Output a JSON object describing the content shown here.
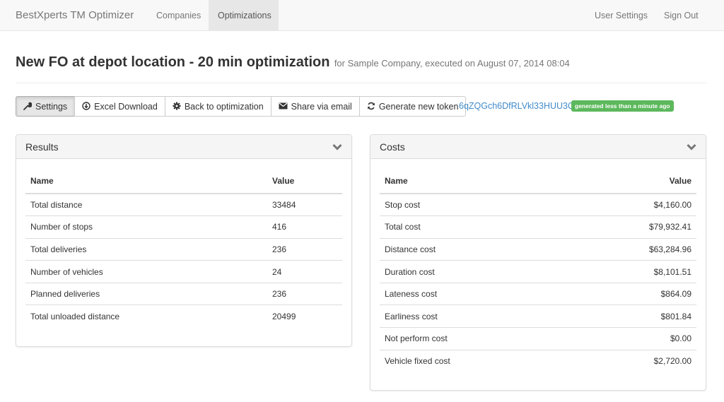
{
  "navbar": {
    "brand": "BestXperts TM Optimizer",
    "left_items": [
      {
        "label": "Companies",
        "active": false
      },
      {
        "label": "Optimizations",
        "active": true
      }
    ],
    "right_items": [
      {
        "label": "User Settings"
      },
      {
        "label": "Sign Out"
      }
    ]
  },
  "header": {
    "title": "New FO at depot location - 20 min optimization",
    "subtitle": "for Sample Company, executed on August 07, 2014 08:04"
  },
  "toolbar": {
    "buttons": [
      {
        "label": "Settings",
        "icon": "wrench-icon",
        "active": true
      },
      {
        "label": "Excel Download",
        "icon": "download-circle-icon",
        "active": false
      },
      {
        "label": "Back to optimization",
        "icon": "cog-icon",
        "active": false
      },
      {
        "label": "Share via email",
        "icon": "envelope-icon",
        "active": false
      },
      {
        "label": "Generate new token",
        "icon": "refresh-icon",
        "active": false
      }
    ],
    "token": "6qZQGch6DfRLVkl33HUU3Q",
    "token_badge": "generated less than a minute ago",
    "badge_color": "#5cb85c",
    "link_color": "#428bca"
  },
  "results": {
    "title": "Results",
    "columns": [
      "Name",
      "Value"
    ],
    "rows": [
      {
        "name": "Total distance",
        "value": "33484"
      },
      {
        "name": "Number of stops",
        "value": "416"
      },
      {
        "name": "Total deliveries",
        "value": "236"
      },
      {
        "name": "Number of vehicles",
        "value": "24"
      },
      {
        "name": "Planned deliveries",
        "value": "236"
      },
      {
        "name": "Total unloaded distance",
        "value": "20499"
      }
    ]
  },
  "costs": {
    "title": "Costs",
    "columns": [
      "Name",
      "Value"
    ],
    "rows": [
      {
        "name": "Stop cost",
        "value": "$4,160.00"
      },
      {
        "name": "Total cost",
        "value": "$79,932.41"
      },
      {
        "name": "Distance cost",
        "value": "$63,284.96"
      },
      {
        "name": "Duration cost",
        "value": "$8,101.51"
      },
      {
        "name": "Lateness cost",
        "value": "$864.09"
      },
      {
        "name": "Earliness cost",
        "value": "$801.84"
      },
      {
        "name": "Not perform cost",
        "value": "$0.00"
      },
      {
        "name": "Vehicle fixed cost",
        "value": "$2,720.00"
      }
    ]
  }
}
